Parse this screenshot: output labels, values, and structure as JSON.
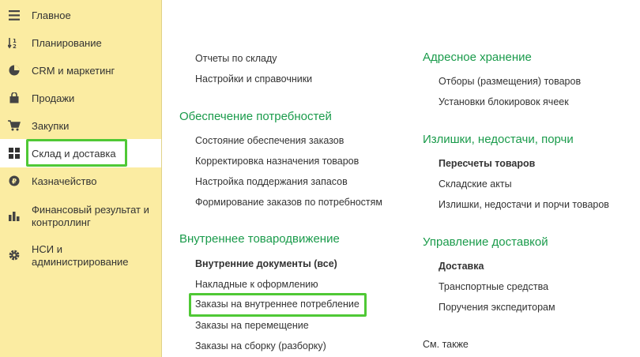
{
  "sidebar": {
    "items": [
      {
        "label": "Главное",
        "icon": "menu-lines-icon"
      },
      {
        "label": "Планирование",
        "icon": "planning-sort-icon"
      },
      {
        "label": "CRM и маркетинг",
        "icon": "pie-chart-icon"
      },
      {
        "label": "Продажи",
        "icon": "shopping-bag-icon"
      },
      {
        "label": "Закупки",
        "icon": "shopping-cart-icon"
      },
      {
        "label": "Склад и доставка",
        "icon": "warehouse-grid-icon",
        "active": true
      },
      {
        "label": "Казначейство",
        "icon": "ruble-coin-icon"
      },
      {
        "label_line1": "Финансовый результат и",
        "label_line2": "контроллинг",
        "icon": "bar-chart-icon"
      },
      {
        "label_line1": "НСИ и",
        "label_line2": "администрирование",
        "icon": "gear-icon"
      }
    ]
  },
  "main": {
    "col1": {
      "top_links": [
        "Отчеты по складу",
        "Настройки и справочники"
      ],
      "sections": [
        {
          "title": "Обеспечение потребностей",
          "links": [
            "Состояние обеспечения заказов",
            "Корректировка назначения товаров",
            "Настройка поддержания запасов",
            "Формирование заказов по потребностям"
          ]
        },
        {
          "title": "Внутреннее товародвижение",
          "links": [
            "Внутренние документы (все)",
            "Накладные к оформлению",
            "Заказы на внутреннее потребление",
            "Заказы на перемещение",
            "Заказы на сборку (разборку)"
          ]
        }
      ]
    },
    "col2": {
      "sections": [
        {
          "title": "Адресное хранение",
          "links": [
            "Отборы (размещения) товаров",
            "Установки блокировок ячеек"
          ]
        },
        {
          "title": "Излишки, недостачи, порчи",
          "links": [
            "Пересчеты товаров",
            "Складские акты",
            "Излишки, недостачи и порчи товаров"
          ]
        },
        {
          "title": "Управление доставкой",
          "links": [
            "Доставка",
            "Транспортные средства",
            "Поручения экспедиторам"
          ]
        }
      ],
      "see_also": "См. также"
    }
  },
  "colors": {
    "sidebar_bg": "#fbeca2",
    "section_title": "#1a9b4b",
    "highlight": "#4fc835"
  }
}
